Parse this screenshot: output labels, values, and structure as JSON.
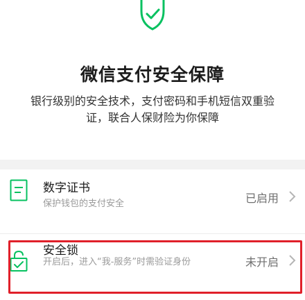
{
  "hero": {
    "icon": "shield-check-icon",
    "title": "微信支付安全保障",
    "description": "银行级别的安全技术，支付密码和手机短信双重验证，联合人保财险为你保障"
  },
  "items": [
    {
      "icon": "certificate-icon",
      "title": "数字证书",
      "subtitle": "保护钱包的支付安全",
      "status": "已启用"
    },
    {
      "icon": "lock-check-icon",
      "title": "安全锁",
      "subtitle": "开启后，进入“我-服务”时需验证身份",
      "status": "未开启"
    }
  ],
  "colors": {
    "accent": "#07c160",
    "highlight": "#e0202a",
    "background_gap": "#f2f2f2"
  }
}
